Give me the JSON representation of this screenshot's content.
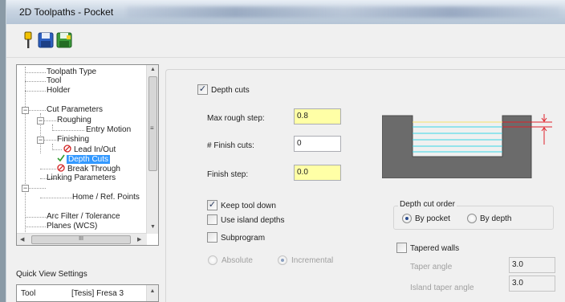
{
  "window": {
    "title": "2D Toolpaths - Pocket"
  },
  "toolbar": {
    "icons": [
      "toolpath-pin-icon",
      "save-icon",
      "save-as-icon"
    ]
  },
  "tree": {
    "items": [
      {
        "label": "Toolpath Type"
      },
      {
        "label": "Tool"
      },
      {
        "label": "Holder"
      },
      {
        "label": "Cut Parameters"
      },
      {
        "label": "Roughing"
      },
      {
        "label": "Entry Motion"
      },
      {
        "label": "Finishing"
      },
      {
        "label": "Lead In/Out"
      },
      {
        "label": "Depth Cuts"
      },
      {
        "label": "Break Through"
      },
      {
        "label": "Linking Parameters"
      },
      {
        "label": "Home / Ref. Points"
      },
      {
        "label": "Arc Filter / Tolerance"
      },
      {
        "label": "Planes (WCS)"
      }
    ],
    "selected": "Depth Cuts",
    "hscroll_grip": "III"
  },
  "quick_view": {
    "title": "Quick View Settings",
    "row": {
      "key": "Tool",
      "value": "[Tesis] Fresa 3"
    }
  },
  "depth_cuts": {
    "enabled_label": "Depth cuts",
    "enabled": true,
    "max_rough_step": {
      "label": "Max rough step:",
      "value": "0.8"
    },
    "finish_cuts": {
      "label": "# Finish cuts:",
      "value": "0"
    },
    "finish_step": {
      "label": "Finish step:",
      "value": "0.0"
    },
    "keep_tool_down": {
      "label": "Keep tool down",
      "checked": true
    },
    "use_island_depths": {
      "label": "Use island depths",
      "checked": false
    },
    "subprogram": {
      "label": "Subprogram",
      "checked": false
    },
    "absolute": {
      "label": "Absolute",
      "selected": false
    },
    "incremental": {
      "label": "Incremental",
      "selected": true
    },
    "order": {
      "title": "Depth cut order",
      "by_pocket": {
        "label": "By pocket",
        "selected": true
      },
      "by_depth": {
        "label": "By depth",
        "selected": false
      }
    },
    "tapered_walls": {
      "label": "Tapered walls",
      "checked": false
    },
    "taper_angle": {
      "label": "Taper angle",
      "value": "3.0"
    },
    "island_taper_angle": {
      "label": "Island taper angle",
      "value": "3.0"
    }
  },
  "colors": {
    "selection": "#3399ff",
    "highlight_field": "#ffffa6",
    "diagram_material": "#6b6b6b",
    "diagram_cuts": "#38d6e6",
    "diagram_arrows": "#e0212a"
  }
}
